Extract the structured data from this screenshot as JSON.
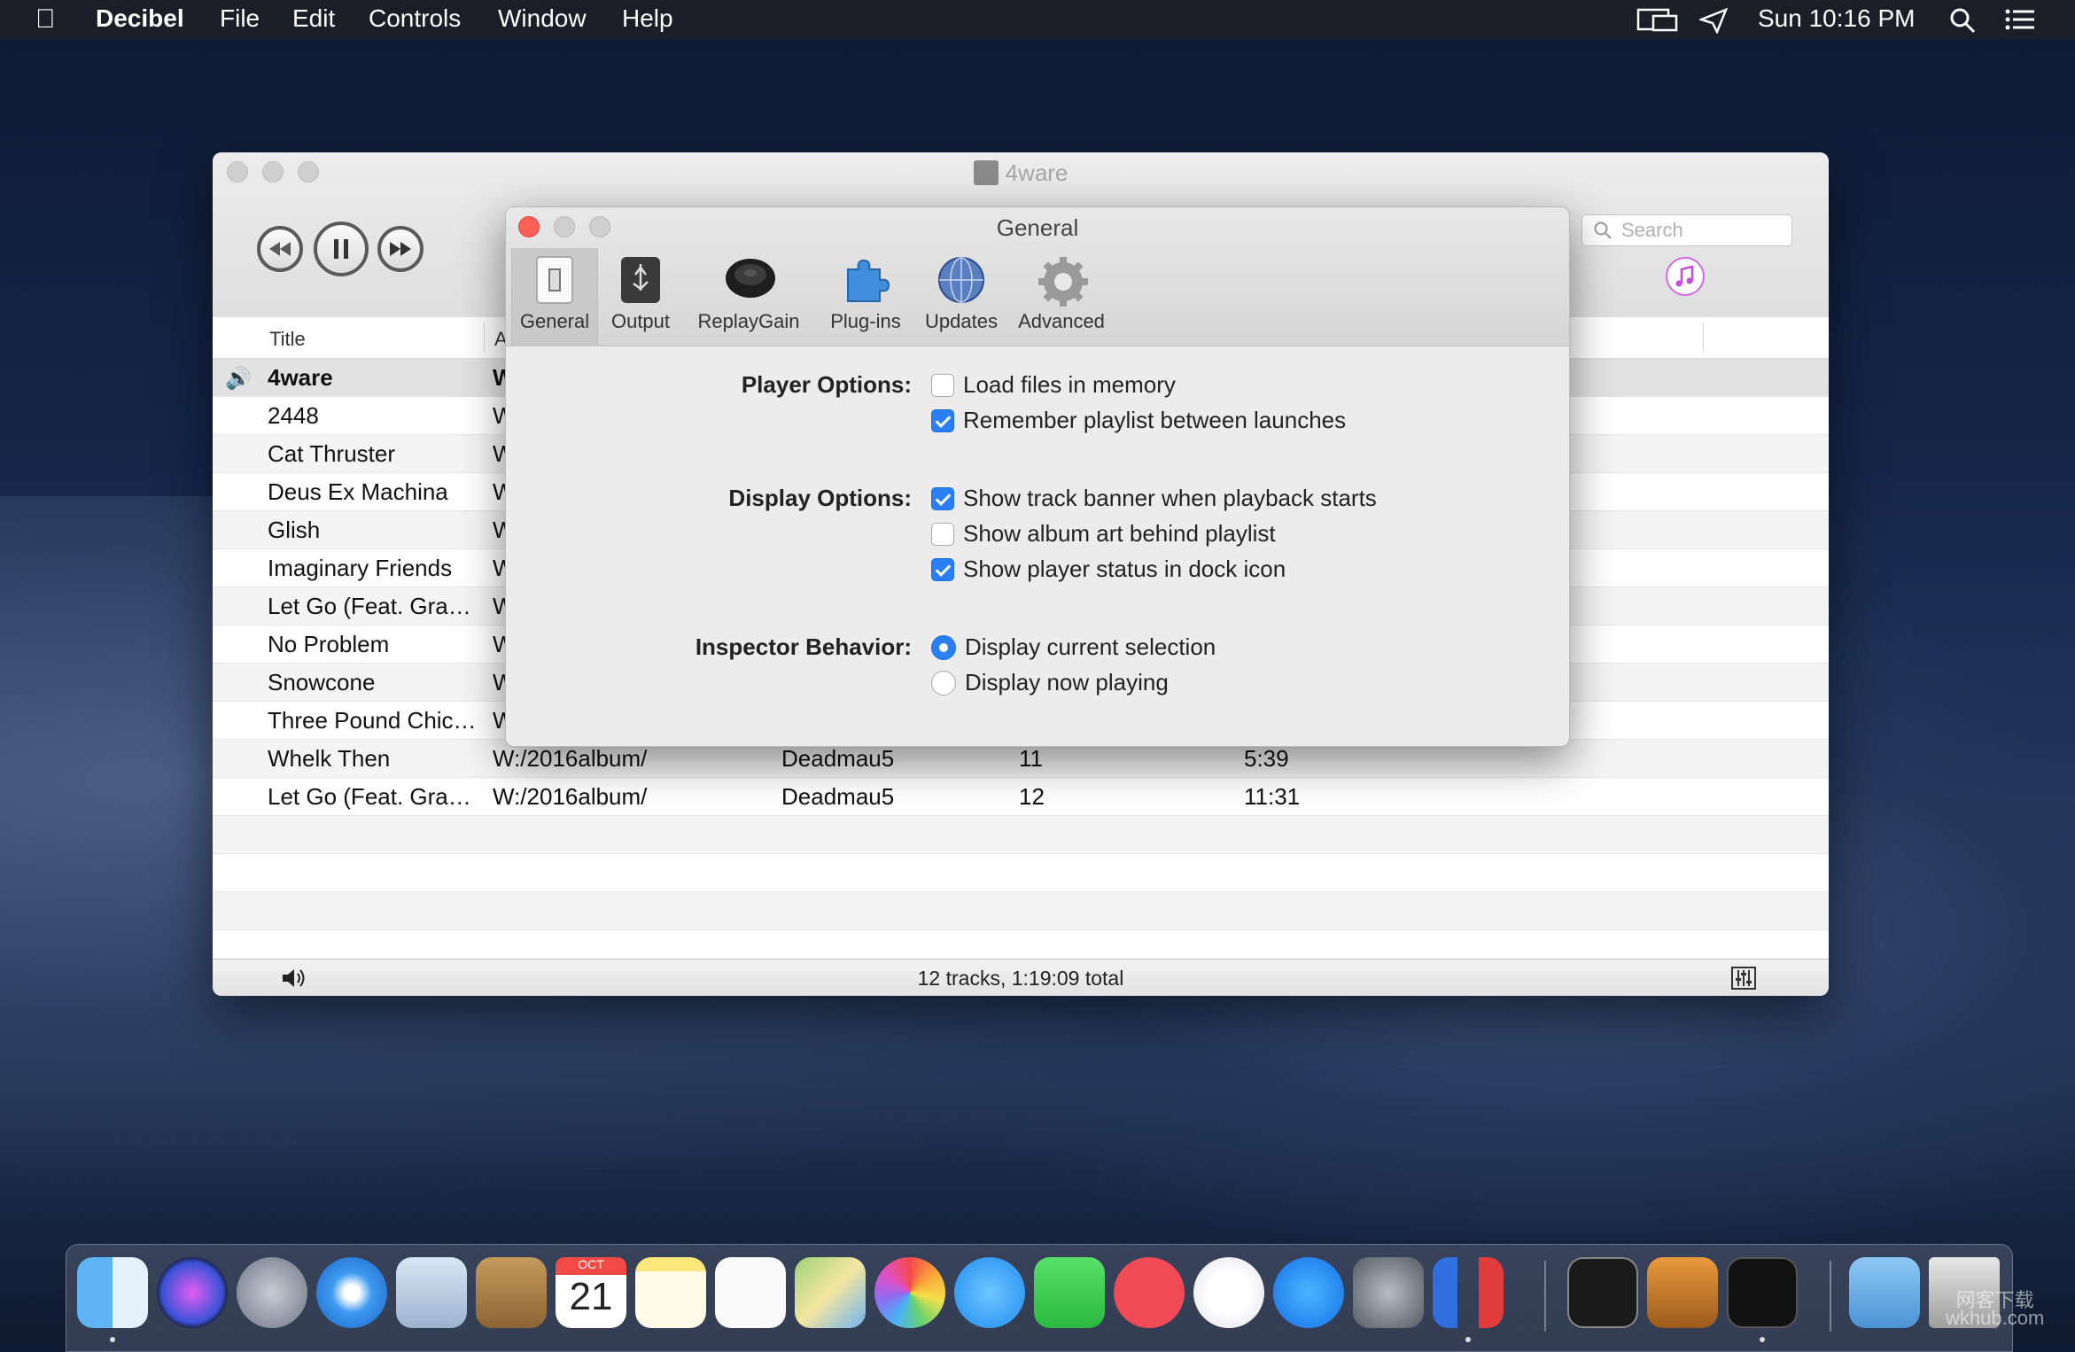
{
  "menubar": {
    "app_name": "Decibel",
    "menus": [
      "File",
      "Edit",
      "Controls",
      "Window",
      "Help"
    ],
    "clock": "Sun 10:16 PM",
    "status_icons": [
      "display-mirroring-icon",
      "send-icon",
      "spotlight-search-icon",
      "notification-center-icon"
    ]
  },
  "window": {
    "title": "4ware",
    "search_placeholder": "Search",
    "columns": [
      "Title",
      "A"
    ],
    "status": "12 tracks, 1:19:09 total",
    "tracks": [
      {
        "title": "4ware",
        "path": "W",
        "artist": "",
        "number": "",
        "duration": ""
      },
      {
        "title": "2448",
        "path": "W",
        "artist": "",
        "number": "",
        "duration": ""
      },
      {
        "title": "Cat Thruster",
        "path": "W",
        "artist": "",
        "number": "",
        "duration": ""
      },
      {
        "title": "Deus Ex Machina",
        "path": "W",
        "artist": "",
        "number": "",
        "duration": ""
      },
      {
        "title": "Glish",
        "path": "W",
        "artist": "",
        "number": "",
        "duration": ""
      },
      {
        "title": "Imaginary Friends",
        "path": "W",
        "artist": "",
        "number": "",
        "duration": ""
      },
      {
        "title": "Let Go (Feat. Gra…",
        "path": "W",
        "artist": "",
        "number": "",
        "duration": ""
      },
      {
        "title": "No Problem",
        "path": "W",
        "artist": "",
        "number": "",
        "duration": ""
      },
      {
        "title": "Snowcone",
        "path": "W",
        "artist": "",
        "number": "",
        "duration": ""
      },
      {
        "title": "Three Pound Chic…",
        "path": "W",
        "artist": "",
        "number": "",
        "duration": ""
      },
      {
        "title": "Whelk Then",
        "path": "W:/2016album/",
        "artist": "Deadmau5",
        "number": "11",
        "duration": "5:39"
      },
      {
        "title": "Let Go (Feat. Gra…",
        "path": "W:/2016album/",
        "artist": "Deadmau5",
        "number": "12",
        "duration": "11:31"
      }
    ]
  },
  "prefs": {
    "title": "General",
    "tabs": [
      "General",
      "Output",
      "ReplayGain",
      "Plug-ins",
      "Updates",
      "Advanced"
    ],
    "player_options_label": "Player Options:",
    "player_options": [
      {
        "label": "Load files in memory",
        "checked": false
      },
      {
        "label": "Remember playlist between launches",
        "checked": true
      }
    ],
    "display_options_label": "Display Options:",
    "display_options": [
      {
        "label": "Show track banner when playback starts",
        "checked": true
      },
      {
        "label": "Show album art behind playlist",
        "checked": false
      },
      {
        "label": "Show player status in dock icon",
        "checked": true
      }
    ],
    "inspector_label": "Inspector Behavior:",
    "inspector_options": [
      {
        "label": "Display current selection",
        "selected": true
      },
      {
        "label": "Display now playing",
        "selected": false
      }
    ]
  },
  "dock": {
    "calendar_month": "OCT",
    "calendar_day": "21",
    "watermark_line1": "网客下载",
    "watermark_line2": "wkhub.com"
  }
}
